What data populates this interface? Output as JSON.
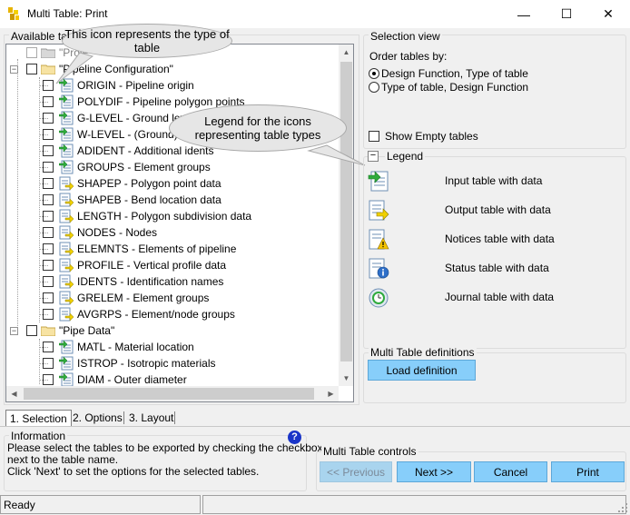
{
  "window": {
    "title": "Multi Table: Print",
    "minimize": "—",
    "maximize": "☐",
    "close": "✕"
  },
  "left_panel": {
    "title": "Available tabl"
  },
  "tree": {
    "projects_label": "\"Proje",
    "group1_label": "\"Pipeline Configuration\"",
    "group1_items": [
      {
        "label": "ORIGIN - Pipeline origin",
        "type": "input"
      },
      {
        "label": "POLYDIF - Pipeline polygon points",
        "type": "input"
      },
      {
        "label": "G-LEVEL - Ground level",
        "type": "input"
      },
      {
        "label": "W-LEVEL - (Ground) wa",
        "type": "input"
      },
      {
        "label": "ADIDENT - Additional idents",
        "type": "input"
      },
      {
        "label": "GROUPS - Element groups",
        "type": "input"
      },
      {
        "label": "SHAPEP - Polygon point data",
        "type": "output"
      },
      {
        "label": "SHAPEB - Bend location data",
        "type": "output"
      },
      {
        "label": "LENGTH - Polygon subdivision data",
        "type": "output"
      },
      {
        "label": "NODES - Nodes",
        "type": "output"
      },
      {
        "label": "ELEMNTS - Elements of pipeline",
        "type": "output"
      },
      {
        "label": "PROFILE - Vertical profile data",
        "type": "output"
      },
      {
        "label": "IDENTS - Identification names",
        "type": "output"
      },
      {
        "label": "GRELEM - Element groups",
        "type": "output"
      },
      {
        "label": "AVGRPS - Element/node groups",
        "type": "output"
      }
    ],
    "group2_label": "\"Pipe Data\"",
    "group2_items": [
      {
        "label": "MATL - Material location",
        "type": "input"
      },
      {
        "label": "ISTROP - Isotropic materials",
        "type": "input"
      },
      {
        "label": "DIAM - Outer diameter",
        "type": "input"
      }
    ]
  },
  "callouts": {
    "type_icon": "This icon represents the type of table",
    "legend_icons": "Legend for the icons representing table types"
  },
  "selection_view": {
    "title": "Selection view",
    "order_label": "Order tables by:",
    "option1": "Design Function, Type of table",
    "option2": "Type of table, Design Function",
    "selected_option": 1,
    "show_empty": "Show Empty tables"
  },
  "legend": {
    "title": "Legend",
    "collapse_glyph": "−",
    "items": [
      {
        "label": "Input table with data",
        "icon": "input-table-icon"
      },
      {
        "label": "Output table with data",
        "icon": "output-table-icon"
      },
      {
        "label": "Notices table with data",
        "icon": "notices-table-icon"
      },
      {
        "label": "Status table with data",
        "icon": "status-table-icon"
      },
      {
        "label": "Journal table with data",
        "icon": "journal-table-icon"
      }
    ]
  },
  "definitions": {
    "title": "Multi Table definitions",
    "load_button": "Load definition"
  },
  "tabs": [
    "1. Selection",
    "2. Options",
    "3. Layout"
  ],
  "information": {
    "title": "Information",
    "text1": "Please select the tables to be exported by checking the checkbox",
    "text2": "next to the table name.",
    "text3": "Click 'Next' to set the options for the selected tables.",
    "help_glyph": "?"
  },
  "controls": {
    "title": "Multi Table controls",
    "previous": "<< Previous",
    "next": "Next >>",
    "cancel": "Cancel",
    "print": "Print"
  },
  "status": {
    "text": "Ready"
  },
  "colors": {
    "button_blue": "#87cefa",
    "input_green": "#2eaa3c",
    "output_yellow": "#f0d000"
  }
}
